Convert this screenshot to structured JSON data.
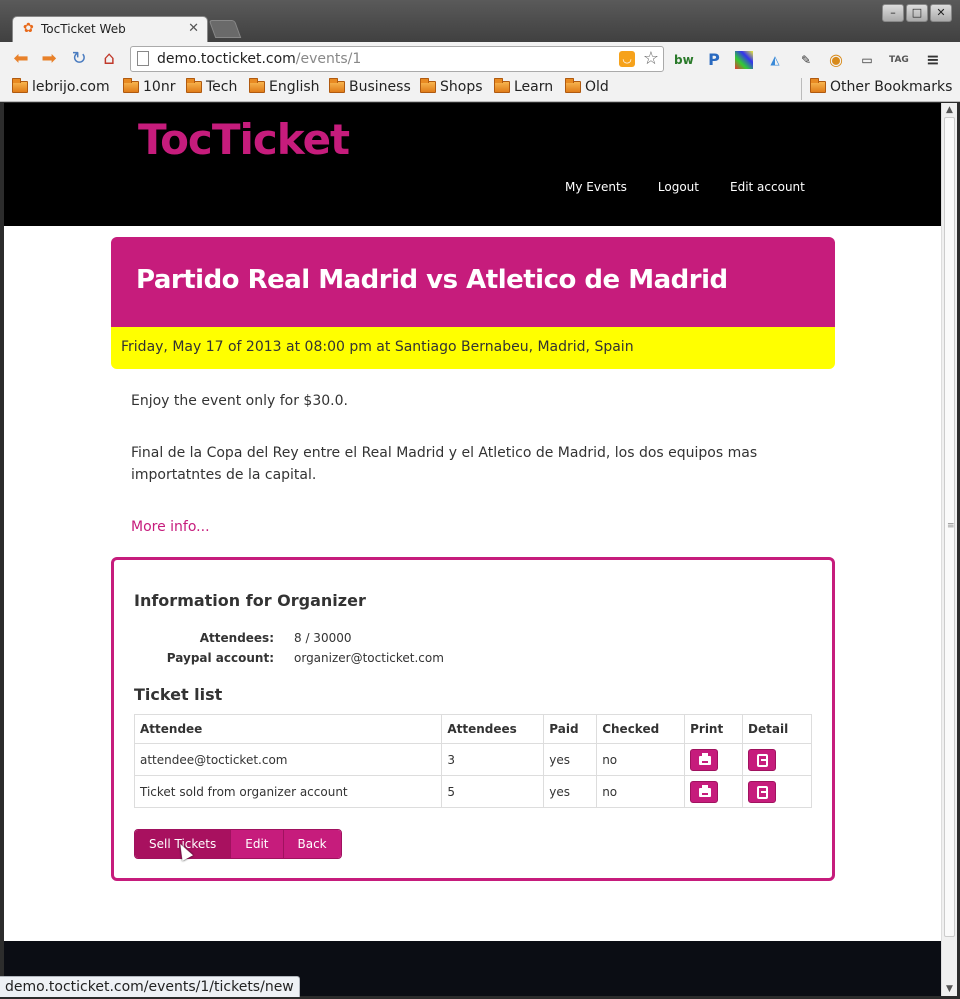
{
  "browser": {
    "tab_title": "TocTicket Web",
    "url_host": "demo.tocticket.com",
    "url_path": "/events/1",
    "status_url": "demo.tocticket.com/events/1/tickets/new",
    "bookmarks": [
      "lebrijo.com",
      "10nr",
      "Tech",
      "English",
      "Business",
      "Shops",
      "Learn",
      "Old"
    ],
    "other_bookmarks": "Other Bookmarks"
  },
  "site": {
    "logo": "TocTicket",
    "nav": [
      "My Events",
      "Logout",
      "Edit account"
    ]
  },
  "event": {
    "title": "Partido Real Madrid vs Atletico de Madrid",
    "date_line": "Friday, May 17 of 2013 at 08:00 pm at Santiago Bernabeu, Madrid, Spain",
    "price_line": "Enjoy the event only for $30.0.",
    "description": "Final de la Copa del Rey entre el Real Madrid y el Atletico de Madrid, los dos equipos mas importatntes de la capital.",
    "more_info": "More info..."
  },
  "organizer": {
    "heading": "Information for Organizer",
    "attendees_label": "Attendees:",
    "attendees_value": "8 / 30000",
    "paypal_label": "Paypal account:",
    "paypal_value": "organizer@tocticket.com"
  },
  "tickets": {
    "heading": "Ticket list",
    "columns": [
      "Attendee",
      "Attendees",
      "Paid",
      "Checked",
      "Print",
      "Detail"
    ],
    "rows": [
      {
        "attendee": "attendee@tocticket.com",
        "attendees": "3",
        "paid": "yes",
        "checked": "no"
      },
      {
        "attendee": "Ticket sold from organizer account",
        "attendees": "5",
        "paid": "yes",
        "checked": "no"
      }
    ]
  },
  "actions": {
    "sell": "Sell Tickets",
    "edit": "Edit",
    "back": "Back"
  },
  "colors": {
    "brand": "#c61c7c",
    "date_bar": "#ffff00",
    "header_bg": "#000000"
  }
}
